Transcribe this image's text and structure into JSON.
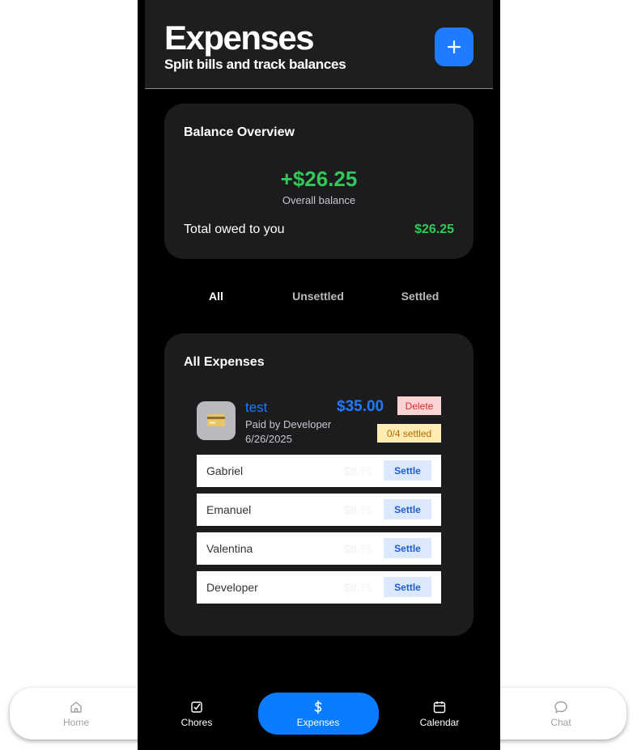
{
  "header": {
    "title": "Expenses",
    "subtitle": "Split bills and track balances",
    "add_icon": "plus-icon"
  },
  "balance": {
    "title": "Balance Overview",
    "amount": "+$26.25",
    "caption": "Overall balance",
    "owed_label": "Total owed to you",
    "owed_value": "$26.25"
  },
  "tabs": [
    {
      "label": "All",
      "active": true
    },
    {
      "label": "Unsettled",
      "active": false
    },
    {
      "label": "Settled",
      "active": false
    }
  ],
  "expenses": {
    "title": "All Expenses",
    "items": [
      {
        "icon": "credit-card-icon",
        "name": "test",
        "paid_by": "Paid by Developer",
        "date": "6/26/2025",
        "amount": "$35.00",
        "delete_label": "Delete",
        "settled_status": "0/4 settled",
        "shares": [
          {
            "name": "Gabriel",
            "amount": "$8.75",
            "action": "Settle"
          },
          {
            "name": "Emanuel",
            "amount": "$8.75",
            "action": "Settle"
          },
          {
            "name": "Valentina",
            "amount": "$8.75",
            "action": "Settle"
          },
          {
            "name": "Developer",
            "amount": "$8.75",
            "action": "Settle"
          }
        ]
      }
    ]
  },
  "nav": {
    "items": [
      {
        "label": "Home",
        "icon": "home-icon",
        "active": false
      },
      {
        "label": "Chores",
        "icon": "checkbox-icon",
        "active": false
      },
      {
        "label": "Expenses",
        "icon": "dollar-icon",
        "active": true
      },
      {
        "label": "Calendar",
        "icon": "calendar-icon",
        "active": false
      },
      {
        "label": "Chat",
        "icon": "chat-bubble-icon",
        "active": false
      }
    ]
  },
  "colors": {
    "accent": "#1f7bff",
    "positive": "#34c759",
    "card": "#1c1c1e",
    "background": "#000000"
  }
}
